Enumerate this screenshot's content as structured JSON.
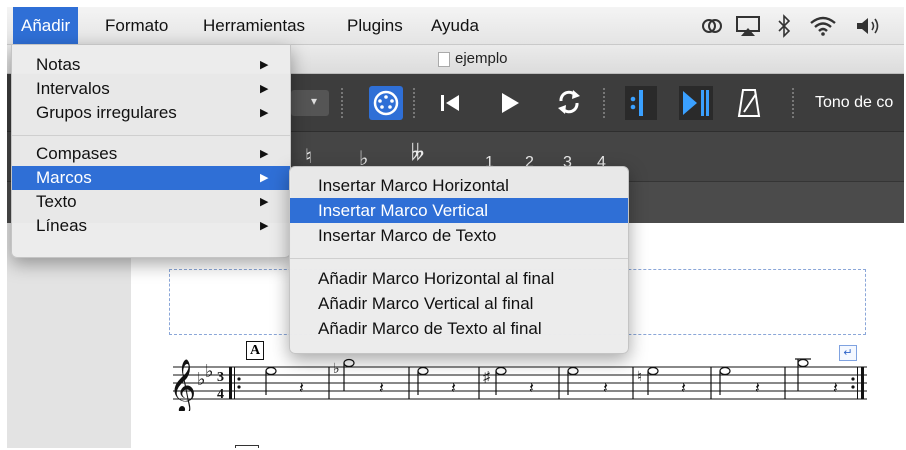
{
  "menubar": {
    "items": [
      "Añadir",
      "Formato",
      "Herramientas",
      "Plugins",
      "Ayuda"
    ],
    "active_index": 0
  },
  "window": {
    "title": "ejemplo"
  },
  "toolbar": {
    "tono_label": "Tono de co"
  },
  "palette": {
    "symbols": [
      "♮",
      "♭",
      "𝄫",
      "1",
      "2",
      "3",
      "4"
    ]
  },
  "score": {
    "rehearsal_mark": "A",
    "time_signature_top": "3",
    "time_signature_bottom": "4"
  },
  "add_menu": {
    "items": [
      {
        "label": "Notas",
        "submenu": true
      },
      {
        "label": "Intervalos",
        "submenu": true
      },
      {
        "label": "Grupos irregulares",
        "submenu": true
      },
      {
        "label": "Compases",
        "submenu": true
      },
      {
        "label": "Marcos",
        "submenu": true,
        "highlighted": true
      },
      {
        "label": "Texto",
        "submenu": true
      },
      {
        "label": "Líneas",
        "submenu": true
      }
    ],
    "arrow": "▶"
  },
  "frames_submenu": {
    "items": [
      {
        "label": "Insertar Marco Horizontal"
      },
      {
        "label": "Insertar Marco Vertical",
        "highlighted": true
      },
      {
        "label": "Insertar Marco de Texto"
      },
      {
        "label": "Añadir Marco Horizontal al final"
      },
      {
        "label": "Añadir Marco Vertical al final"
      },
      {
        "label": "Añadir Marco de Texto al final"
      }
    ]
  },
  "colors": {
    "highlight": "#2f6fd6",
    "toolbar_bg": "#3d3d3d",
    "toolbar_accent": "#3aa0ff"
  }
}
